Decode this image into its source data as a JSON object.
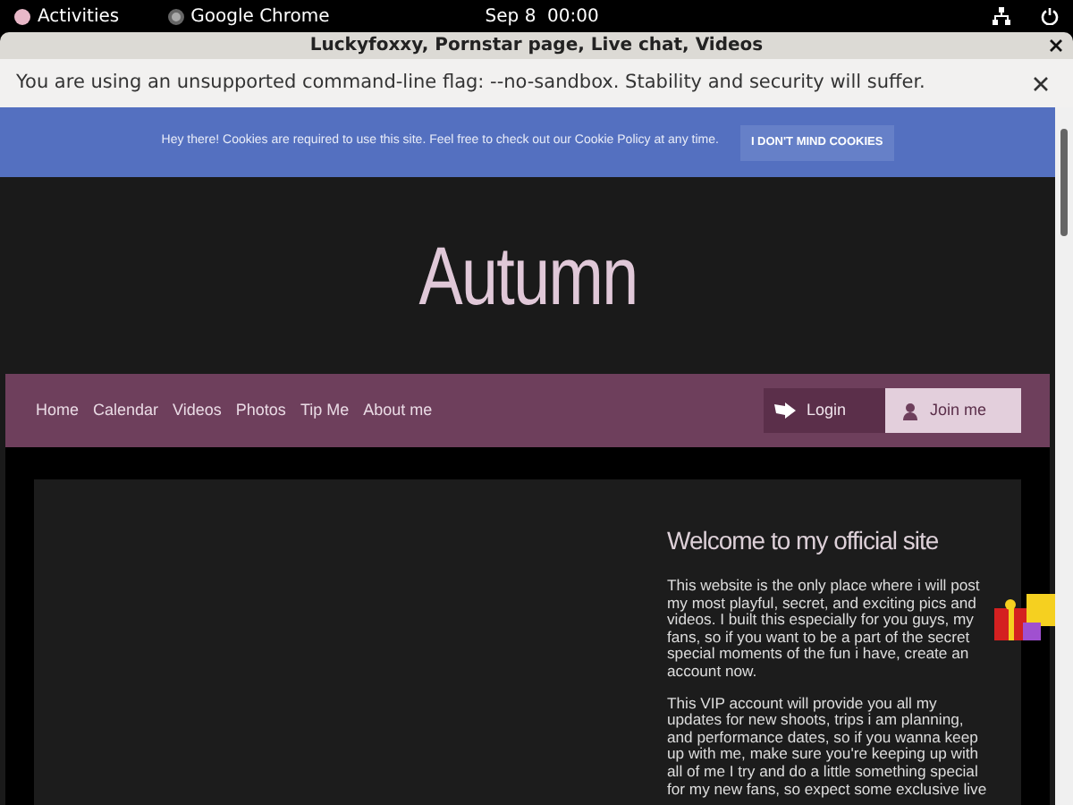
{
  "top_bar": {
    "activities": "Activities",
    "app": "Google Chrome",
    "clock": "Sep 8  00:00"
  },
  "window": {
    "title": "Luckyfoxxy, Pornstar page, Live chat, Videos"
  },
  "infobar": {
    "message": "You are using an unsupported command-line flag: --no-sandbox. Stability and security will suffer."
  },
  "cookie_banner": {
    "message": "Hey there! Cookies are required to use this site. Feel free to check out our Cookie Policy at any time.",
    "button": "I DON'T MIND COOKIES"
  },
  "site_title": "Autumn",
  "nav": {
    "items": [
      "Home",
      "Calendar",
      "Videos",
      "Photos",
      "Tip Me",
      "About me"
    ],
    "login": "Login",
    "join": "Join me"
  },
  "content": {
    "heading": "Welcome to my official site",
    "paragraphs": [
      "This website is the only place where i will post my most playful, secret, and exciting pics and videos. I built this especially for you guys, my fans, so if you want to be a part of the secret special moments of the fun i have, create an account now.",
      "This VIP account will provide you all my updates for new shoots, trips i am planning, and performance dates, so if you wanna keep up with me, make sure you're keeping up with all of me I try and do a little something special for my new fans, so expect some exclusive live"
    ]
  }
}
